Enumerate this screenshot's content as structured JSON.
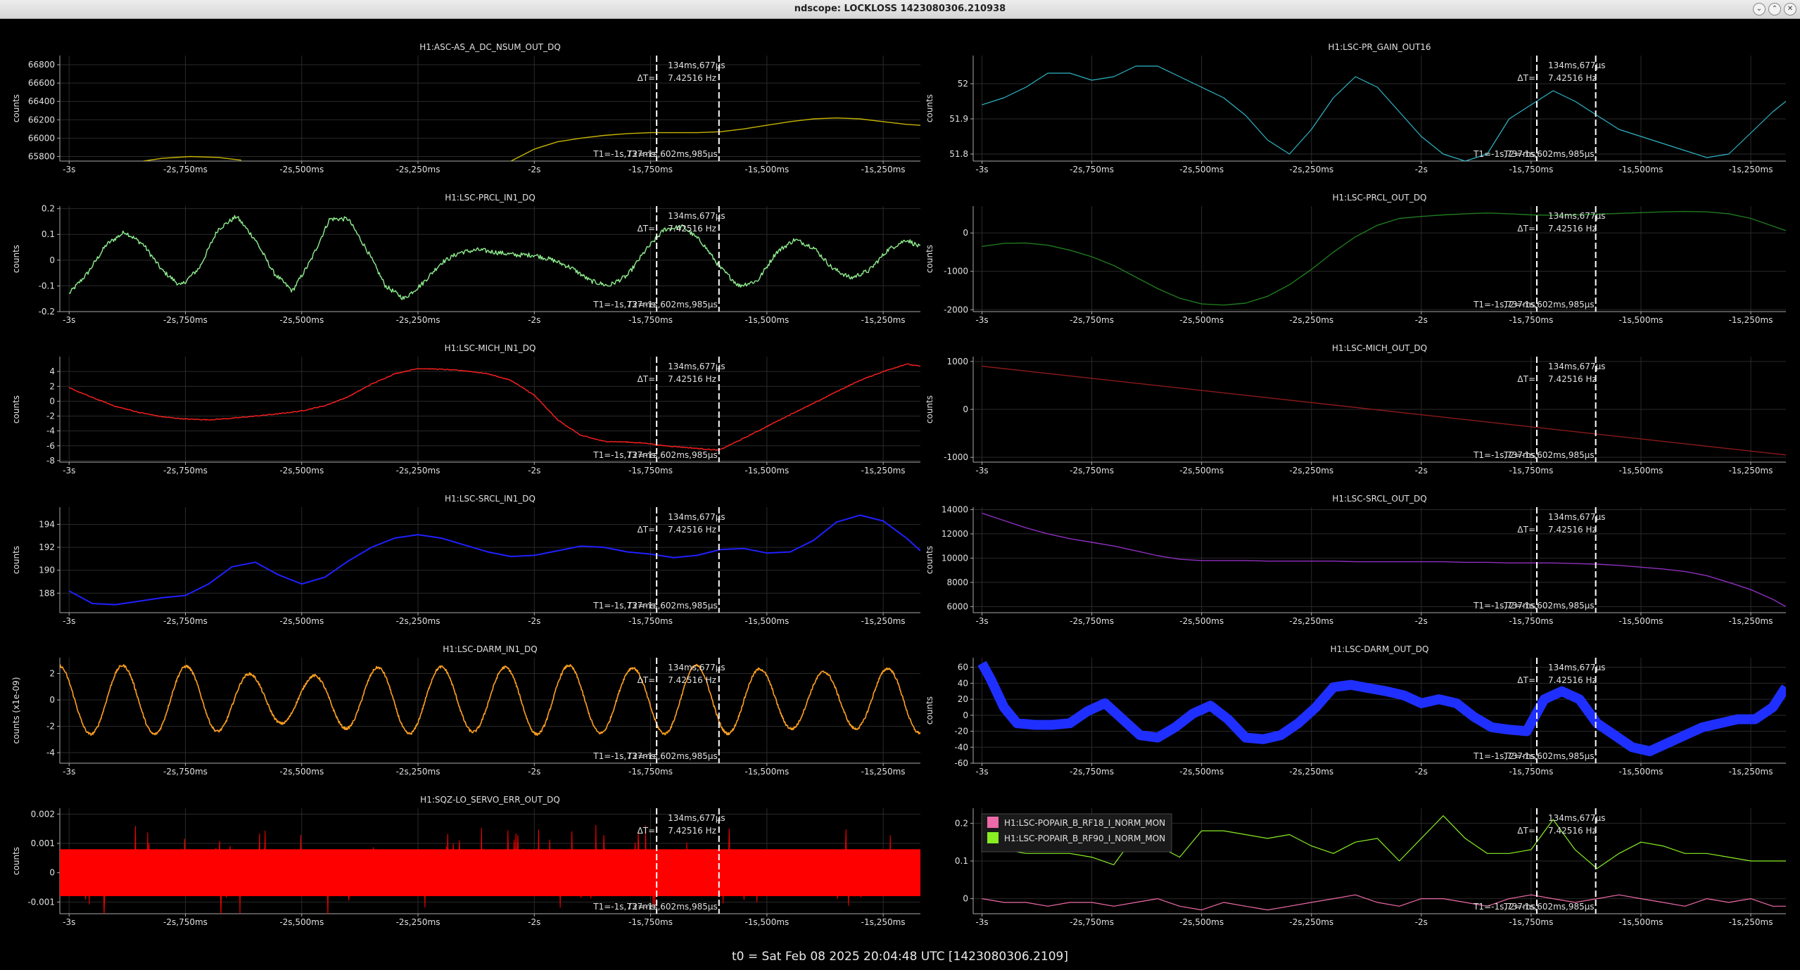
{
  "window": {
    "title": "ndscope: LOCKLOSS 1423080306.210938",
    "buttons": [
      "minimize",
      "maximize",
      "close"
    ]
  },
  "footer": "t0 = Sat Feb 08 2025 20:04:48 UTC [1423080306.2109]",
  "colors": {
    "background": "#000000",
    "grid": "#2a2a2a",
    "axis": "#aaaaaa",
    "cursor": "#ffffff"
  },
  "cursors": {
    "t1": "T1=-1s,737ms",
    "t2": "T2=-1s,602ms,985µs",
    "delta_label": "ΔT=",
    "delta_value": "134ms,677µs",
    "freq": "7.42516 Hz",
    "t1_value": -1.737,
    "t2_value": -1.602985
  },
  "chart_data": [
    {
      "type": "line",
      "title": "H1:ASC-AS_A_DC_NSUM_OUT_DQ",
      "ylabel": "counts",
      "color": "#c8b400",
      "noise": 0,
      "thick": 1.4,
      "xlim": [
        -3.02,
        -1.17
      ],
      "ylim": [
        65750,
        66900
      ],
      "yticks": [
        65800,
        66000,
        66200,
        66400,
        66600,
        66800
      ],
      "x": [
        -2.84,
        -2.8,
        -2.74,
        -2.68,
        -2.63,
        -2.05,
        -2.0,
        -1.95,
        -1.9,
        -1.85,
        -1.8,
        -1.75,
        -1.7,
        -1.65,
        -1.6,
        -1.55,
        -1.5,
        -1.45,
        -1.4,
        -1.35,
        -1.3,
        -1.25,
        -1.2,
        -1.17
      ],
      "values": [
        65750,
        65780,
        65800,
        65790,
        65760,
        65750,
        65880,
        65960,
        66000,
        66030,
        66050,
        66060,
        66060,
        66060,
        66070,
        66100,
        66140,
        66180,
        66210,
        66220,
        66210,
        66180,
        66150,
        66140
      ]
    },
    {
      "type": "line",
      "title": "H1:LSC-PR_GAIN_OUT16",
      "ylabel": "counts",
      "color": "#2fb5c5",
      "noise": 0,
      "thick": 1.2,
      "xlim": [
        -3.02,
        -1.17
      ],
      "ylim": [
        51.78,
        52.08
      ],
      "yticks": [
        51.8,
        51.9,
        52.0
      ],
      "x": [
        -3.0,
        -2.95,
        -2.9,
        -2.85,
        -2.8,
        -2.75,
        -2.7,
        -2.65,
        -2.6,
        -2.55,
        -2.5,
        -2.45,
        -2.4,
        -2.35,
        -2.3,
        -2.25,
        -2.2,
        -2.15,
        -2.1,
        -2.05,
        -2.0,
        -1.95,
        -1.9,
        -1.85,
        -1.8,
        -1.75,
        -1.7,
        -1.65,
        -1.6,
        -1.55,
        -1.5,
        -1.45,
        -1.4,
        -1.35,
        -1.3,
        -1.25,
        -1.2,
        -1.17
      ],
      "values": [
        51.94,
        51.96,
        51.99,
        52.03,
        52.03,
        52.01,
        52.02,
        52.05,
        52.05,
        52.02,
        51.99,
        51.96,
        51.91,
        51.84,
        51.8,
        51.87,
        51.96,
        52.02,
        51.99,
        51.92,
        51.85,
        51.8,
        51.78,
        51.8,
        51.9,
        51.94,
        51.98,
        51.95,
        51.91,
        51.87,
        51.85,
        51.83,
        51.81,
        51.79,
        51.8,
        51.86,
        51.92,
        51.95
      ]
    },
    {
      "type": "line",
      "title": "H1:LSC-PRCL_IN1_DQ",
      "ylabel": "counts",
      "color": "#8fef8f",
      "noise": 0.009,
      "thick": 1.4,
      "xlim": [
        -3.02,
        -1.17
      ],
      "ylim": [
        -0.2,
        0.21
      ],
      "yticks": [
        -0.2,
        -0.1,
        0,
        0.1,
        0.2
      ],
      "x": [
        -3.0,
        -2.96,
        -2.92,
        -2.88,
        -2.84,
        -2.8,
        -2.76,
        -2.72,
        -2.68,
        -2.64,
        -2.6,
        -2.56,
        -2.52,
        -2.48,
        -2.44,
        -2.4,
        -2.36,
        -2.32,
        -2.28,
        -2.24,
        -2.2,
        -2.16,
        -2.12,
        -2.08,
        -2.04,
        -2.0,
        -1.96,
        -1.92,
        -1.88,
        -1.84,
        -1.8,
        -1.76,
        -1.72,
        -1.68,
        -1.64,
        -1.6,
        -1.56,
        -1.52,
        -1.48,
        -1.44,
        -1.4,
        -1.36,
        -1.32,
        -1.28,
        -1.24,
        -1.2,
        -1.17
      ],
      "values": [
        -0.13,
        -0.05,
        0.06,
        0.11,
        0.06,
        -0.04,
        -0.1,
        -0.03,
        0.12,
        0.17,
        0.08,
        -0.05,
        -0.12,
        0.0,
        0.16,
        0.16,
        0.04,
        -0.1,
        -0.15,
        -0.09,
        -0.01,
        0.03,
        0.04,
        0.03,
        0.02,
        0.02,
        0.0,
        -0.03,
        -0.08,
        -0.1,
        -0.06,
        0.04,
        0.12,
        0.13,
        0.07,
        -0.03,
        -0.1,
        -0.08,
        0.03,
        0.08,
        0.05,
        -0.03,
        -0.07,
        -0.04,
        0.04,
        0.08,
        0.05
      ]
    },
    {
      "type": "line",
      "title": "H1:LSC-PRCL_OUT_DQ",
      "ylabel": "counts",
      "color": "#1f7a1f",
      "noise": 0,
      "thick": 1.4,
      "xlim": [
        -3.02,
        -1.17
      ],
      "ylim": [
        -2050,
        700
      ],
      "yticks": [
        -2000,
        -1000,
        0
      ],
      "x": [
        -3.0,
        -2.95,
        -2.9,
        -2.85,
        -2.8,
        -2.75,
        -2.7,
        -2.65,
        -2.6,
        -2.55,
        -2.5,
        -2.45,
        -2.4,
        -2.35,
        -2.3,
        -2.25,
        -2.2,
        -2.15,
        -2.1,
        -2.05,
        -2.0,
        -1.95,
        -1.9,
        -1.85,
        -1.8,
        -1.75,
        -1.7,
        -1.65,
        -1.6,
        -1.55,
        -1.5,
        -1.45,
        -1.4,
        -1.35,
        -1.3,
        -1.25,
        -1.2,
        -1.17
      ],
      "values": [
        -350,
        -270,
        -260,
        -320,
        -450,
        -620,
        -850,
        -1150,
        -1450,
        -1700,
        -1850,
        -1880,
        -1830,
        -1650,
        -1350,
        -950,
        -500,
        -100,
        200,
        380,
        430,
        470,
        500,
        520,
        500,
        470,
        460,
        470,
        490,
        510,
        530,
        550,
        560,
        550,
        500,
        380,
        180,
        60
      ]
    },
    {
      "type": "line",
      "title": "H1:LSC-MICH_IN1_DQ",
      "ylabel": "counts",
      "color": "#ff2020",
      "noise": 0.06,
      "thick": 1.4,
      "xlim": [
        -3.02,
        -1.17
      ],
      "ylim": [
        -8.2,
        6
      ],
      "yticks": [
        -8,
        -6,
        -4,
        -2,
        0,
        2,
        4
      ],
      "x": [
        -3.0,
        -2.95,
        -2.9,
        -2.85,
        -2.8,
        -2.75,
        -2.7,
        -2.65,
        -2.6,
        -2.55,
        -2.5,
        -2.45,
        -2.4,
        -2.35,
        -2.3,
        -2.25,
        -2.2,
        -2.15,
        -2.1,
        -2.05,
        -2.0,
        -1.95,
        -1.9,
        -1.85,
        -1.8,
        -1.75,
        -1.737,
        -1.603,
        -1.6,
        -1.55,
        -1.5,
        -1.45,
        -1.4,
        -1.35,
        -1.3,
        -1.25,
        -1.2,
        -1.17
      ],
      "values": [
        1.8,
        0.5,
        -0.7,
        -1.5,
        -2.1,
        -2.4,
        -2.5,
        -2.3,
        -2.0,
        -1.7,
        -1.3,
        -0.6,
        0.6,
        2.3,
        3.7,
        4.4,
        4.3,
        4.1,
        3.7,
        2.8,
        0.8,
        -2.5,
        -4.6,
        -5.4,
        -5.5,
        -5.7,
        -5.9,
        -6.6,
        -6.5,
        -5.0,
        -3.4,
        -1.8,
        -0.3,
        1.3,
        2.8,
        4.0,
        5.0,
        4.7
      ]
    },
    {
      "type": "line",
      "title": "H1:LSC-MICH_OUT_DQ",
      "ylabel": "counts",
      "color": "#8b1a1a",
      "noise": 0,
      "thick": 1.4,
      "xlim": [
        -3.02,
        -1.17
      ],
      "ylim": [
        -1100,
        1100
      ],
      "yticks": [
        -1000,
        0,
        1000
      ],
      "x": [
        -3.0,
        -1.17
      ],
      "values": [
        900,
        -950
      ]
    },
    {
      "type": "line",
      "title": "H1:LSC-SRCL_IN1_DQ",
      "ylabel": "counts",
      "color": "#2020ff",
      "noise": 0,
      "thick": 2,
      "xlim": [
        -3.02,
        -1.17
      ],
      "ylim": [
        186.3,
        195.5
      ],
      "yticks": [
        188,
        190,
        192,
        194
      ],
      "x": [
        -3.0,
        -2.95,
        -2.9,
        -2.85,
        -2.8,
        -2.75,
        -2.7,
        -2.65,
        -2.6,
        -2.55,
        -2.5,
        -2.45,
        -2.4,
        -2.35,
        -2.3,
        -2.25,
        -2.2,
        -2.15,
        -2.1,
        -2.05,
        -2.0,
        -1.95,
        -1.9,
        -1.85,
        -1.8,
        -1.75,
        -1.7,
        -1.65,
        -1.6,
        -1.55,
        -1.5,
        -1.45,
        -1.4,
        -1.35,
        -1.3,
        -1.25,
        -1.2,
        -1.17
      ],
      "values": [
        188.2,
        187.1,
        187.0,
        187.3,
        187.6,
        187.8,
        188.8,
        190.3,
        190.7,
        189.6,
        188.8,
        189.4,
        190.8,
        192.0,
        192.8,
        193.1,
        192.8,
        192.2,
        191.6,
        191.2,
        191.3,
        191.7,
        192.1,
        192.0,
        191.6,
        191.4,
        191.1,
        191.3,
        191.8,
        191.9,
        191.5,
        191.6,
        192.6,
        194.2,
        194.8,
        194.3,
        192.8,
        191.7
      ]
    },
    {
      "type": "line",
      "title": "H1:LSC-SRCL_OUT_DQ",
      "ylabel": "counts",
      "color": "#8f2fbf",
      "noise": 0,
      "thick": 1.4,
      "xlim": [
        -3.02,
        -1.17
      ],
      "ylim": [
        5500,
        14200
      ],
      "yticks": [
        6000,
        8000,
        10000,
        12000,
        14000
      ],
      "x": [
        -3.0,
        -2.95,
        -2.9,
        -2.85,
        -2.8,
        -2.75,
        -2.7,
        -2.65,
        -2.6,
        -2.55,
        -2.5,
        -2.45,
        -2.4,
        -2.35,
        -2.3,
        -2.25,
        -2.2,
        -2.15,
        -2.1,
        -2.05,
        -2.0,
        -1.95,
        -1.9,
        -1.85,
        -1.8,
        -1.75,
        -1.7,
        -1.65,
        -1.6,
        -1.55,
        -1.5,
        -1.45,
        -1.4,
        -1.35,
        -1.3,
        -1.25,
        -1.2,
        -1.17
      ],
      "values": [
        13700,
        13100,
        12500,
        12000,
        11600,
        11300,
        11000,
        10600,
        10200,
        9900,
        9800,
        9800,
        9800,
        9750,
        9750,
        9750,
        9750,
        9700,
        9700,
        9700,
        9700,
        9700,
        9650,
        9650,
        9600,
        9600,
        9600,
        9550,
        9500,
        9400,
        9250,
        9100,
        8900,
        8550,
        8000,
        7400,
        6600,
        6000
      ]
    },
    {
      "type": "line",
      "title": "H1:LSC-DARM_IN1_DQ",
      "ylabel": "counts (x1e-09)",
      "color": "#ffa020",
      "noise": 0.1,
      "thick": 1.6,
      "periods": 13.5,
      "phase": 0.1,
      "xlim": [
        -3.02,
        -1.17
      ],
      "ylim": [
        -4.8,
        3.2
      ],
      "yticks": [
        -4,
        -2,
        0,
        2
      ],
      "x": [
        -3.0,
        -2.9,
        -2.8,
        -2.7,
        -2.6,
        -2.5,
        -2.4,
        -2.3,
        -2.2,
        -2.1,
        -2.0,
        -1.9,
        -1.8,
        -1.7,
        -1.6,
        -1.5,
        -1.4,
        -1.3,
        -1.2,
        -1.17
      ],
      "values": [
        2.6,
        2.6,
        2.6,
        2.5,
        1.9,
        1.7,
        2.2,
        2.6,
        2.5,
        2.4,
        2.6,
        2.6,
        2.4,
        2.6,
        2.6,
        2.3,
        2.1,
        2.2,
        2.5,
        2.5
      ]
    },
    {
      "type": "line",
      "title": "H1:LSC-DARM_OUT_DQ",
      "ylabel": "counts",
      "color": "#1f2fff",
      "noise": 0,
      "thick": 2,
      "band": true,
      "xlim": [
        -3.02,
        -1.17
      ],
      "ylim": [
        -60,
        72
      ],
      "yticks": [
        -60,
        -40,
        -20,
        0,
        20,
        40,
        60
      ],
      "x": [
        -3.0,
        -2.98,
        -2.95,
        -2.92,
        -2.88,
        -2.84,
        -2.8,
        -2.76,
        -2.72,
        -2.68,
        -2.64,
        -2.6,
        -2.56,
        -2.52,
        -2.48,
        -2.44,
        -2.4,
        -2.36,
        -2.32,
        -2.28,
        -2.24,
        -2.2,
        -2.16,
        -2.12,
        -2.08,
        -2.04,
        -2.0,
        -1.96,
        -1.92,
        -1.88,
        -1.84,
        -1.8,
        -1.76,
        -1.72,
        -1.68,
        -1.64,
        -1.6,
        -1.56,
        -1.52,
        -1.48,
        -1.44,
        -1.4,
        -1.36,
        -1.32,
        -1.28,
        -1.24,
        -1.2,
        -1.17
      ],
      "values": [
        65,
        45,
        10,
        -10,
        -12,
        -12,
        -10,
        5,
        15,
        -5,
        -25,
        -28,
        -15,
        2,
        12,
        -5,
        -28,
        -30,
        -25,
        -10,
        10,
        35,
        38,
        34,
        30,
        25,
        15,
        20,
        15,
        -2,
        -15,
        -18,
        -20,
        20,
        30,
        20,
        -10,
        -25,
        -40,
        -45,
        -35,
        -25,
        -15,
        -10,
        -5,
        -5,
        10,
        35
      ]
    },
    {
      "type": "line",
      "title": "H1:SQZ-LO_SERVO_ERR_OUT_DQ",
      "ylabel": "counts",
      "color": "#ff0000",
      "noise": 0,
      "thick": 1,
      "band": true,
      "xlim": [
        -3.02,
        -1.17
      ],
      "ylim": [
        -0.0014,
        0.0022
      ],
      "yticks": [
        -0.001,
        0,
        0.001,
        0.002
      ],
      "x": [
        -3.0,
        -1.17
      ],
      "values": [
        0.0,
        0.0
      ]
    },
    {
      "type": "line",
      "title": "",
      "ylabel": "",
      "color": "#88ee22",
      "noise": 0,
      "thick": 1.2,
      "xlim": [
        -3.02,
        -1.17
      ],
      "ylim": [
        -0.04,
        0.24
      ],
      "yticks": [
        0,
        0.1,
        0.2
      ],
      "legend": [
        "H1:LSC-POPAIR_B_RF18_I_NORM_MON",
        "H1:LSC-POPAIR_B_RF90_I_NORM_MON"
      ],
      "series": [
        {
          "name": "H1:LSC-POPAIR_B_RF18_I_NORM_MON",
          "color": "#ee6aa8",
          "x": [
            -3.0,
            -2.95,
            -2.9,
            -2.85,
            -2.8,
            -2.75,
            -2.7,
            -2.65,
            -2.6,
            -2.55,
            -2.5,
            -2.45,
            -2.4,
            -2.35,
            -2.3,
            -2.25,
            -2.2,
            -2.15,
            -2.1,
            -2.05,
            -2.0,
            -1.95,
            -1.9,
            -1.85,
            -1.8,
            -1.75,
            -1.7,
            -1.65,
            -1.6,
            -1.55,
            -1.5,
            -1.45,
            -1.4,
            -1.35,
            -1.3,
            -1.25,
            -1.2,
            -1.17
          ],
          "values": [
            0.0,
            -0.01,
            -0.01,
            -0.02,
            -0.01,
            -0.01,
            -0.02,
            -0.01,
            0.0,
            -0.02,
            -0.03,
            -0.01,
            -0.02,
            -0.03,
            -0.02,
            -0.01,
            0.0,
            0.01,
            -0.01,
            -0.02,
            0.0,
            0.0,
            -0.01,
            -0.02,
            0.0,
            0.01,
            0.0,
            -0.01,
            0.0,
            0.01,
            0.0,
            -0.01,
            -0.02,
            0.0,
            -0.01,
            0.0,
            -0.02,
            -0.02
          ]
        },
        {
          "name": "H1:LSC-POPAIR_B_RF90_I_NORM_MON",
          "color": "#88ee22",
          "x": [
            -3.0,
            -2.95,
            -2.9,
            -2.85,
            -2.8,
            -2.75,
            -2.7,
            -2.65,
            -2.6,
            -2.55,
            -2.5,
            -2.45,
            -2.4,
            -2.35,
            -2.3,
            -2.25,
            -2.2,
            -2.15,
            -2.1,
            -2.05,
            -2.0,
            -1.95,
            -1.9,
            -1.85,
            -1.8,
            -1.75,
            -1.7,
            -1.65,
            -1.6,
            -1.55,
            -1.5,
            -1.45,
            -1.4,
            -1.35,
            -1.3,
            -1.25,
            -1.2,
            -1.17
          ],
          "values": [
            0.13,
            0.13,
            0.12,
            0.12,
            0.12,
            0.11,
            0.09,
            0.17,
            0.14,
            0.11,
            0.18,
            0.18,
            0.17,
            0.16,
            0.17,
            0.14,
            0.12,
            0.15,
            0.16,
            0.1,
            0.16,
            0.22,
            0.16,
            0.12,
            0.12,
            0.13,
            0.21,
            0.13,
            0.08,
            0.12,
            0.15,
            0.14,
            0.12,
            0.12,
            0.11,
            0.1,
            0.1,
            0.1
          ]
        }
      ]
    }
  ],
  "x_ticks": {
    "values": [
      -3.0,
      -2.75,
      -2.5,
      -2.25,
      -2.0,
      -1.75,
      -1.5,
      -1.25
    ],
    "labels": [
      "-3s",
      "-2s,750ms",
      "-2s,500ms",
      "-2s,250ms",
      "-2s",
      "-1s,750ms",
      "-1s,500ms",
      "-1s,250ms"
    ]
  }
}
